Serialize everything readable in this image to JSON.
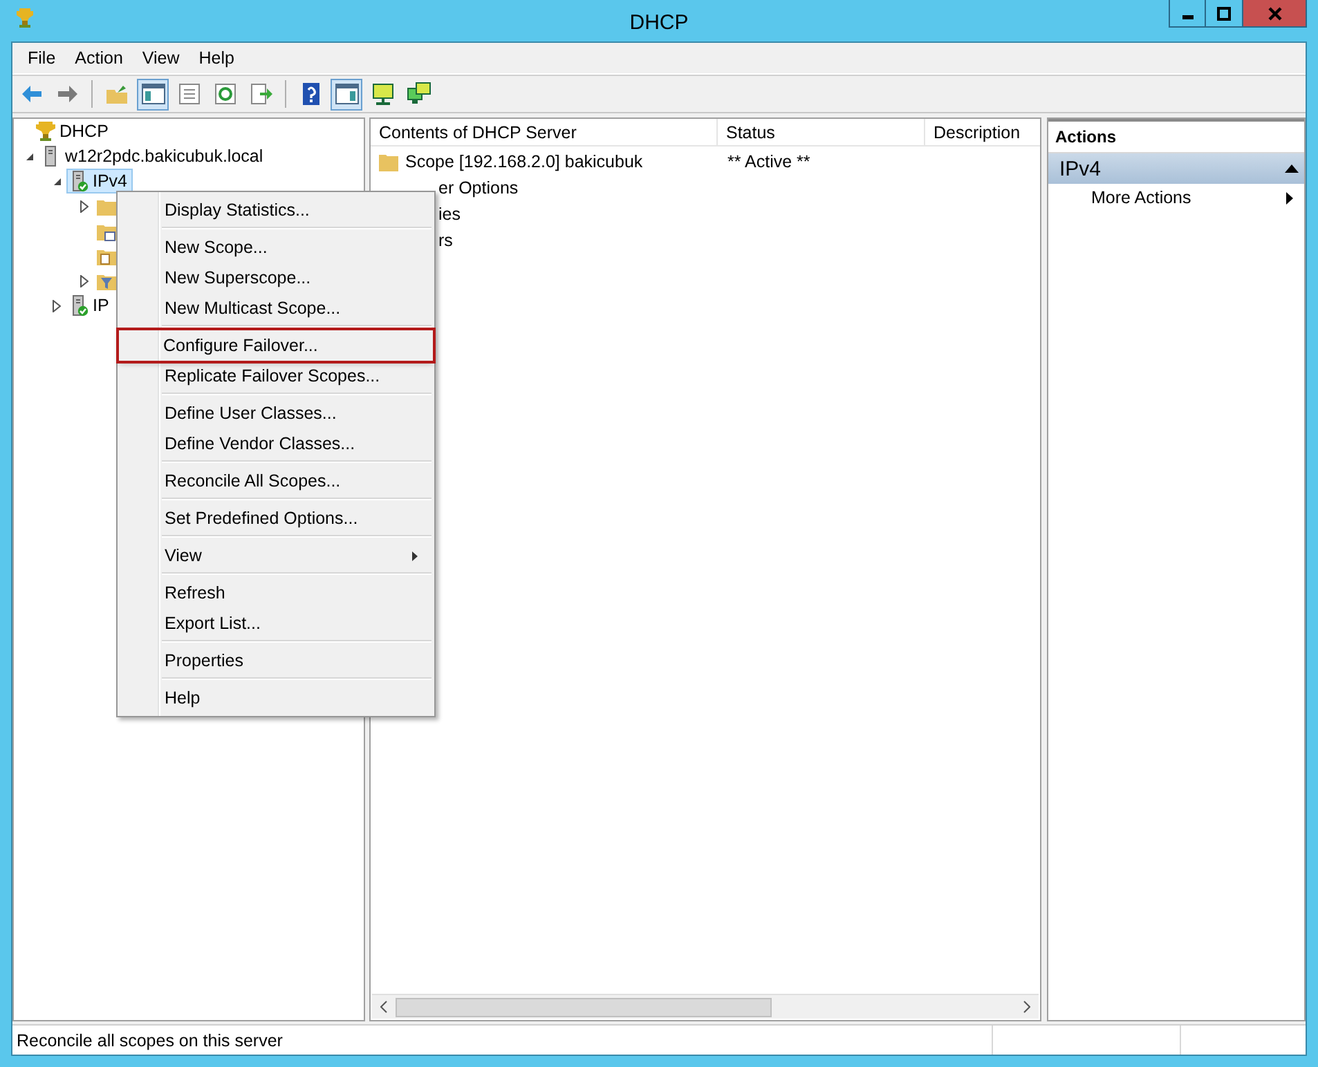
{
  "window": {
    "title": "DHCP"
  },
  "menu_bar": [
    "File",
    "Action",
    "View",
    "Help"
  ],
  "toolbar": [
    {
      "kind": "back",
      "pressed": false
    },
    {
      "kind": "forward",
      "pressed": false
    },
    {
      "kind": "separator"
    },
    {
      "kind": "up-folder",
      "pressed": false
    },
    {
      "kind": "tree-pane",
      "pressed": true
    },
    {
      "kind": "list",
      "pressed": false
    },
    {
      "kind": "refresh",
      "pressed": false
    },
    {
      "kind": "export",
      "pressed": false
    },
    {
      "kind": "separator"
    },
    {
      "kind": "help",
      "pressed": false
    },
    {
      "kind": "action-pane",
      "pressed": true
    },
    {
      "kind": "monitor",
      "pressed": false
    },
    {
      "kind": "monitors",
      "pressed": false
    }
  ],
  "tree": [
    {
      "label": "DHCP",
      "kind": "trophy",
      "children": [
        {
          "label": "w12r2pdc.bakicubuk.local",
          "kind": "server",
          "expanded": true,
          "selected": false,
          "children": [
            {
              "label": "IPv4",
              "kind": "server-check",
              "expanded": true,
              "selected": true,
              "children": [
                {
                  "kind": "folder",
                  "expanded": false,
                  "selected": false
                },
                {
                  "kind": "folder-grid",
                  "selected": false
                },
                {
                  "kind": "folder-doc",
                  "selected": false
                },
                {
                  "kind": "filter",
                  "expanded": false,
                  "selected": false
                }
              ]
            },
            {
              "label": "IP",
              "kind": "server-check",
              "expanded": false,
              "selected": false
            }
          ]
        }
      ]
    }
  ],
  "content": {
    "columns": [
      "Contents of DHCP Server",
      "Status",
      "Description"
    ],
    "rows": [
      {
        "kind": "full",
        "name": "Scope [192.168.2.0] bakicubuk",
        "status": "** Active **"
      },
      {
        "kind": "partial",
        "name": "er Options"
      },
      {
        "kind": "partial",
        "name": "ies"
      },
      {
        "kind": "partial",
        "name": "rs"
      }
    ]
  },
  "context_menu": [
    {
      "kind": "item",
      "label": "Display Statistics...",
      "highlighted": false,
      "submenu": false
    },
    {
      "kind": "separator"
    },
    {
      "kind": "item",
      "label": "New Scope...",
      "highlighted": false,
      "submenu": false
    },
    {
      "kind": "item",
      "label": "New Superscope...",
      "highlighted": false,
      "submenu": false
    },
    {
      "kind": "item",
      "label": "New Multicast Scope...",
      "highlighted": false,
      "submenu": false
    },
    {
      "kind": "separator"
    },
    {
      "kind": "item",
      "label": "Configure Failover...",
      "highlighted": true,
      "submenu": false
    },
    {
      "kind": "item",
      "label": "Replicate Failover Scopes...",
      "highlighted": false,
      "submenu": false
    },
    {
      "kind": "separator"
    },
    {
      "kind": "item",
      "label": "Define User Classes...",
      "highlighted": false,
      "submenu": false
    },
    {
      "kind": "item",
      "label": "Define Vendor Classes...",
      "highlighted": false,
      "submenu": false
    },
    {
      "kind": "separator"
    },
    {
      "kind": "item",
      "label": "Reconcile All Scopes...",
      "highlighted": false,
      "submenu": false
    },
    {
      "kind": "separator"
    },
    {
      "kind": "item",
      "label": "Set Predefined Options...",
      "highlighted": false,
      "submenu": false
    },
    {
      "kind": "separator"
    },
    {
      "kind": "item",
      "label": "View",
      "highlighted": false,
      "submenu": true
    },
    {
      "kind": "separator"
    },
    {
      "kind": "item",
      "label": "Refresh",
      "highlighted": false,
      "submenu": false
    },
    {
      "kind": "item",
      "label": "Export List...",
      "highlighted": false,
      "submenu": false
    },
    {
      "kind": "separator"
    },
    {
      "kind": "item",
      "label": "Properties",
      "highlighted": false,
      "submenu": false
    },
    {
      "kind": "separator"
    },
    {
      "kind": "item",
      "label": "Help",
      "highlighted": false,
      "submenu": false
    }
  ],
  "actions": {
    "title": "Actions",
    "group": {
      "label": "IPv4",
      "expanded": true
    },
    "items": [
      {
        "label": "More Actions",
        "submenu": true
      }
    ]
  },
  "status_bar": {
    "text": "Reconcile all scopes on this server"
  }
}
